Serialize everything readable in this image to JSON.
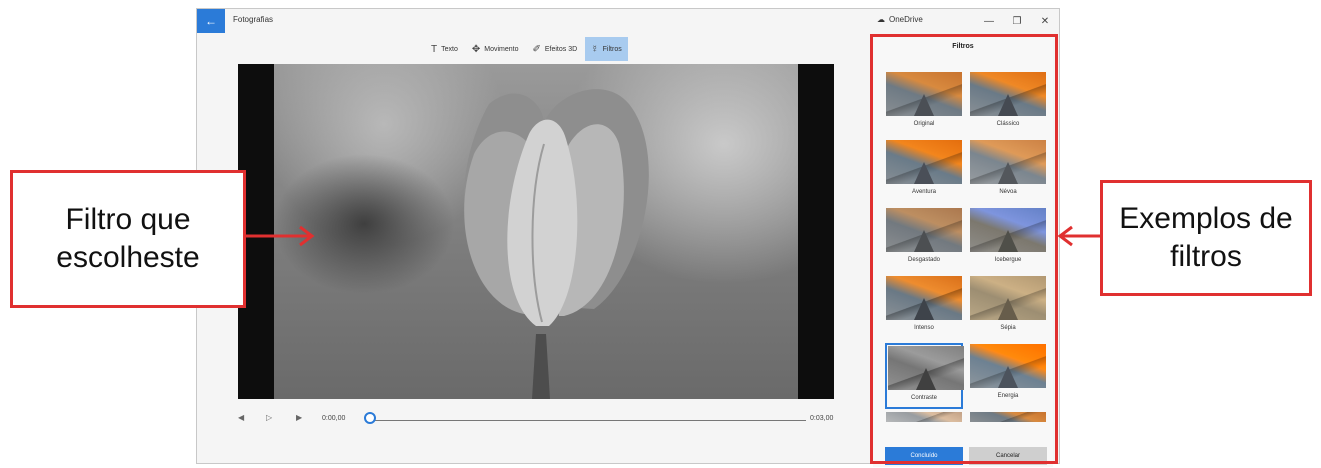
{
  "window": {
    "title": "Fotografias",
    "back_icon": "←",
    "onedrive_label": "OneDrive",
    "controls": [
      "—",
      "❐",
      "✕"
    ]
  },
  "toolbar": {
    "items": [
      {
        "label": "Texto",
        "icon": "T"
      },
      {
        "label": "Movimento",
        "icon": "✥"
      },
      {
        "label": "Efeitos 3D",
        "icon": "✐"
      },
      {
        "label": "Filtros",
        "icon": "☿"
      }
    ],
    "active_index": 3
  },
  "playback": {
    "prev_icon": "◀",
    "play_icon": "▷",
    "next_icon": "▶",
    "current_time": "0:00,00",
    "end_time": "0:03,00",
    "progress": 0
  },
  "panel": {
    "title": "Filtros",
    "filters": [
      {
        "label": "Original"
      },
      {
        "label": "Clássico"
      },
      {
        "label": "Aventura"
      },
      {
        "label": "Névoa"
      },
      {
        "label": "Desgastado"
      },
      {
        "label": "Icebergue"
      },
      {
        "label": "Intenso"
      },
      {
        "label": "Sépia"
      },
      {
        "label": "Contraste"
      },
      {
        "label": "Energia"
      }
    ],
    "selected_index": 8,
    "done_label": "Concluído",
    "cancel_label": "Cancelar"
  },
  "annotations": {
    "left_callout": "Filtro que escolheste",
    "right_callout": "Exemplos de filtros"
  },
  "colors": {
    "accent": "#2b7bd8",
    "annotation_red": "#e03030"
  }
}
